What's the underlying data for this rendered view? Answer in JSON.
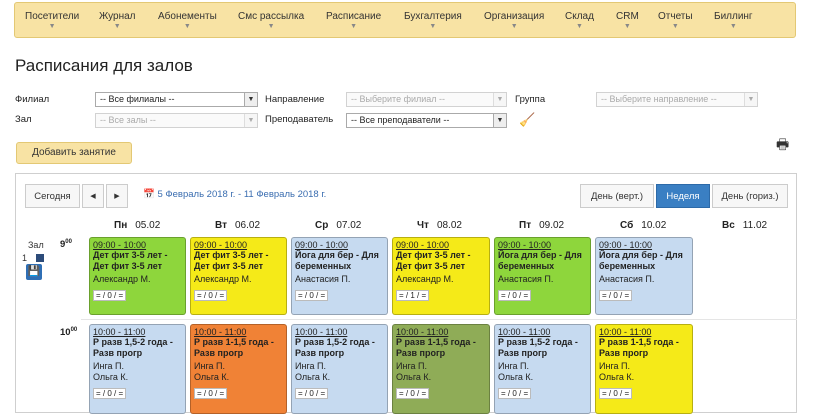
{
  "nav": {
    "items": [
      "Посетители",
      "Журнал",
      "Абонементы",
      "Смс рассылка",
      "Расписание",
      "Бухгалтерия",
      "Организация",
      "Склад",
      "CRM",
      "Отчеты",
      "Биллинг"
    ],
    "caret": "▼"
  },
  "page": {
    "title": "Расписания для залов"
  },
  "filters": {
    "branch_label": "Филиал",
    "branch_value": "-- Все филиалы --",
    "direction_label": "Направление",
    "direction_value": "-- Выберите филиал --",
    "group_label": "Группа",
    "group_value": "-- Выберите направление --",
    "hall_label": "Зал",
    "hall_value": "-- Все залы --",
    "teacher_label": "Преподаватель",
    "teacher_value": "-- Все преподаватели --",
    "arrow": "▼"
  },
  "actions": {
    "add_button": "Добавить занятие",
    "print_icon": "🖶",
    "clear_icon": "🧹"
  },
  "calendar": {
    "today_button": "Сегодня",
    "prev_icon": "◀",
    "next_icon": "▶",
    "calendar_icon": "📅",
    "date_range": "5 Февраль 2018 г. - 11 Февраль 2018 г.",
    "views": [
      "День (верт.)",
      "Неделя",
      "День (гориз.)"
    ],
    "active_view": "Неделя",
    "days": [
      {
        "dow": "Пн",
        "date": "05.02"
      },
      {
        "dow": "Вт",
        "date": "06.02"
      },
      {
        "dow": "Ср",
        "date": "07.02"
      },
      {
        "dow": "Чт",
        "date": "08.02"
      },
      {
        "dow": "Пт",
        "date": "09.02"
      },
      {
        "dow": "Сб",
        "date": "10.02"
      },
      {
        "dow": "Вс",
        "date": "11.02"
      }
    ],
    "hours": [
      "9",
      "10"
    ],
    "hour_suffix": "00",
    "room": {
      "label": "Зал",
      "number": "1",
      "save_icon": "💾"
    },
    "events_9": [
      {
        "time": "09:00 - 10:00",
        "name": "Дет фит 3-5 лет - Дет фит 3-5 лет",
        "teacher": "Александр М.",
        "count": "= / 0 / =",
        "color": "#8ed63c"
      },
      {
        "time": "09:00 - 10:00",
        "name": "Дет фит 3-5 лет - Дет фит 3-5 лет",
        "teacher": "Александр М.",
        "count": "= / 0 / =",
        "color": "#f5ea18"
      },
      {
        "time": "09:00 - 10:00",
        "name": "Йога для бер - Для беременных",
        "teacher": "Анастасия П.",
        "count": "= / 0 / =",
        "color": "#c6daf0"
      },
      {
        "time": "09:00 - 10:00",
        "name": "Дет фит 3-5 лет - Дет фит 3-5 лет",
        "teacher": "Александр М.",
        "count": "= / 1 / =",
        "color": "#f5ea18"
      },
      {
        "time": "09:00 - 10:00",
        "name": "Йога для бер - Для беременных",
        "teacher": "Анастасия П.",
        "count": "= / 0 / =",
        "color": "#8ed63c"
      },
      {
        "time": "09:00 - 10:00",
        "name": "Йога для бер - Для беременных",
        "teacher": "Анастасия П.",
        "count": "= / 0 / =",
        "color": "#c6daf0"
      }
    ],
    "events_10": [
      {
        "time": "10:00 - 11:00",
        "name": "Р разв 1,5-2 года - Разв прогр",
        "teacher": "Инга П.",
        "teacher2": "Ольга К.",
        "count": "= / 0 / =",
        "color": "#c6daf0"
      },
      {
        "time": "10:00 - 11:00",
        "name": "Р разв 1-1,5 года - Разв прогр",
        "teacher": "Инга П.",
        "teacher2": "Ольга К.",
        "count": "= / 0 / =",
        "color": "#f08236"
      },
      {
        "time": "10:00 - 11:00",
        "name": "Р разв 1,5-2 года - Разв прогр",
        "teacher": "Инга П.",
        "teacher2": "Ольга К.",
        "count": "= / 0 / =",
        "color": "#c6daf0"
      },
      {
        "time": "10:00 - 11:00",
        "name": "Р разв 1-1,5 года - Разв прогр",
        "teacher": "Инга П.",
        "teacher2": "Ольга К.",
        "count": "= / 0 / =",
        "color": "#8fac57"
      },
      {
        "time": "10:00 - 11:00",
        "name": "Р разв 1,5-2 года - Разв прогр",
        "teacher": "Инга П.",
        "teacher2": "Ольга К.",
        "count": "= / 0 / =",
        "color": "#c6daf0"
      },
      {
        "time": "10:00 - 11:00",
        "name": "Р разв 1-1,5 года - Разв прогр",
        "teacher": "Инга П.",
        "teacher2": "Ольга К.",
        "count": "= / 0 / =",
        "color": "#f5ea18"
      }
    ]
  }
}
